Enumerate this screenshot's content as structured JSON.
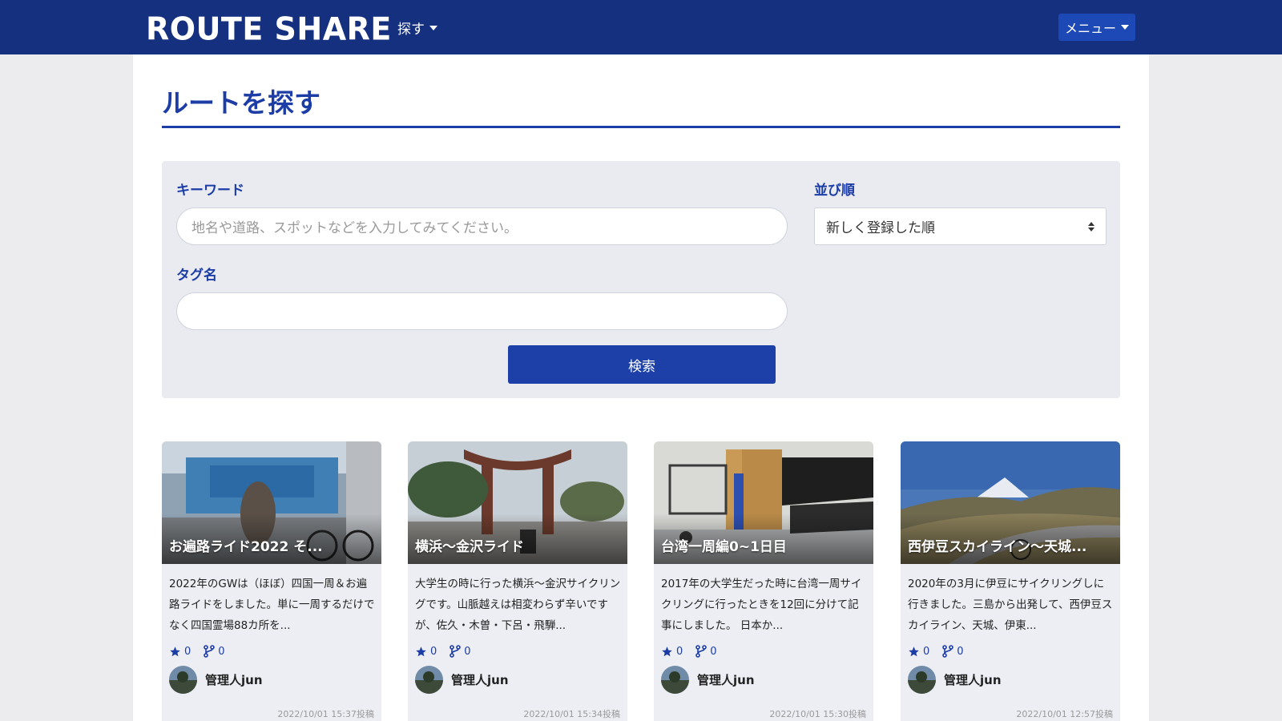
{
  "header": {
    "logo": "ROUTE SHARE",
    "nav_find": "探す",
    "menu": "メニュー"
  },
  "page": {
    "title": "ルートを探す"
  },
  "search": {
    "keyword_label": "キーワード",
    "keyword_placeholder": "地名や道路、スポットなどを入力してみてください。",
    "keyword_value": "",
    "sort_label": "並び順",
    "sort_value": "新しく登録した順",
    "tag_label": "タグ名",
    "tag_value": "",
    "submit": "検索"
  },
  "cards": [
    {
      "title": "お遍路ライド2022 そ...",
      "desc": "2022年のGWは（ほぼ）四国一周＆お遍路ライドをしました。単に一周するだけでなく四国霊場88カ所を...",
      "stars": "0",
      "forks": "0",
      "author": "管理人jun",
      "date": "2022/10/01 15:37投稿"
    },
    {
      "title": "横浜～金沢ライド",
      "desc": "大学生の時に行った横浜～金沢サイクリングです。山脈越えは相変わらず辛いですが、佐久・木曽・下呂・飛騨...",
      "stars": "0",
      "forks": "0",
      "author": "管理人jun",
      "date": "2022/10/01 15:34投稿"
    },
    {
      "title": "台湾一周編0~1日目",
      "desc": "2017年の大学生だった時に台湾一周サイクリングに行ったときを12回に分けて記事にしました。 日本か...",
      "stars": "0",
      "forks": "0",
      "author": "管理人jun",
      "date": "2022/10/01 15:30投稿"
    },
    {
      "title": "西伊豆スカイライン～天城...",
      "desc": "2020年の3月に伊豆にサイクリングしに行きました。三島から出発して、西伊豆スカイライン、天城、伊東...",
      "stars": "0",
      "forks": "0",
      "author": "管理人jun",
      "date": "2022/10/01 12:57投稿"
    }
  ]
}
